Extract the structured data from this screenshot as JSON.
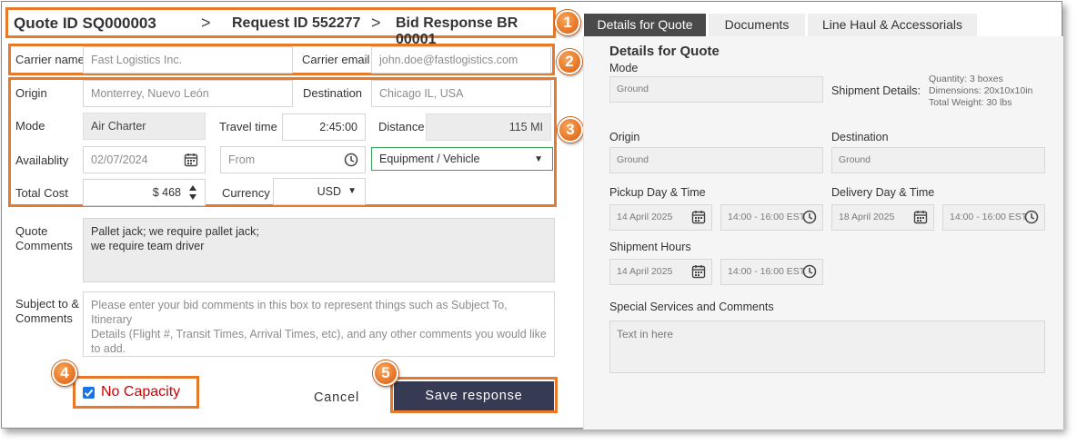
{
  "breadcrumb": {
    "quote": "Quote ID SQ000003",
    "request": "Request ID 552277",
    "bid": "Bid Response BR 00001",
    "separator": ">"
  },
  "badges": [
    "1",
    "2",
    "3",
    "4",
    "5"
  ],
  "carrier": {
    "name_label": "Carrier name",
    "name_value": "Fast Logistics Inc.",
    "email_label": "Carrier email",
    "email_value": "john.doe@fastlogistics.com"
  },
  "route": {
    "origin_label": "Origin",
    "origin_value": "Monterrey, Nuevo León",
    "destination_label": "Destination",
    "destination_value": "Chicago IL, USA",
    "mode_label": "Mode",
    "mode_value": "Air Charter",
    "travel_time_label": "Travel time",
    "travel_time_value": "2:45:00",
    "distance_label": "Distance",
    "distance_value": "115 MI",
    "availability_label": "Availablity",
    "availability_date": "02/07/2024",
    "from_placeholder": "From",
    "equipment_value": "Equipment / Vehicle",
    "total_cost_label": "Total Cost",
    "total_cost_value": "$ 468",
    "currency_label": "Currency",
    "currency_value": "USD"
  },
  "quote_comments": {
    "label_line1": "Quote",
    "label_line2": "Comments",
    "line1": "Pallet jack; we require pallet jack;",
    "line2": "we require team driver"
  },
  "subject_comments": {
    "label_line1": "Subject to &",
    "label_line2": "Comments",
    "placeholder_line1": "Please enter your bid comments in this box to represent things such as Subject To, Itinerary",
    "placeholder_line2": "Details (Flight #, Transit Times, Arrival Times, etc), and any other comments you would like",
    "placeholder_line3": "to add."
  },
  "no_capacity": {
    "label": "No Capacity",
    "checked": true
  },
  "actions": {
    "cancel": "Cancel",
    "save": "Save response"
  },
  "tabs": [
    {
      "label": "Details for Quote",
      "active": true
    },
    {
      "label": "Documents",
      "active": false
    },
    {
      "label": "Line Haul & Accessorials",
      "active": false
    }
  ],
  "details": {
    "title": "Details for Quote",
    "mode_label": "Mode",
    "mode_value": "Ground",
    "shipment_details_label": "Shipment Details:",
    "quantity": "Quantity: 3 boxes",
    "dimensions": "Dimensions: 20x10x10in",
    "weight": "Total Weight: 30 lbs",
    "origin_label": "Origin",
    "origin_value": "Ground",
    "destination_label": "Destination",
    "destination_value": "Ground",
    "pickup_label": "Pickup Day & Time",
    "pickup_date": "14 April 2025",
    "pickup_time": "14:00 - 16:00 EST",
    "delivery_label": "Delivery Day & Time",
    "delivery_date": "18 April 2025",
    "delivery_time": "14:00 - 16:00 EST",
    "hours_label": "Shipment Hours",
    "hours_date": "14 April 2025",
    "hours_time": "14:00 - 16:00 EST",
    "special_label": "Special Services and Comments",
    "special_placeholder": "Text in here"
  },
  "colors": {
    "annotation": "#e8782a",
    "save_button": "#363a52",
    "active_tab": "#4a4a4a",
    "no_capacity_text": "#d40000",
    "equipment_border": "#3aa35a"
  }
}
